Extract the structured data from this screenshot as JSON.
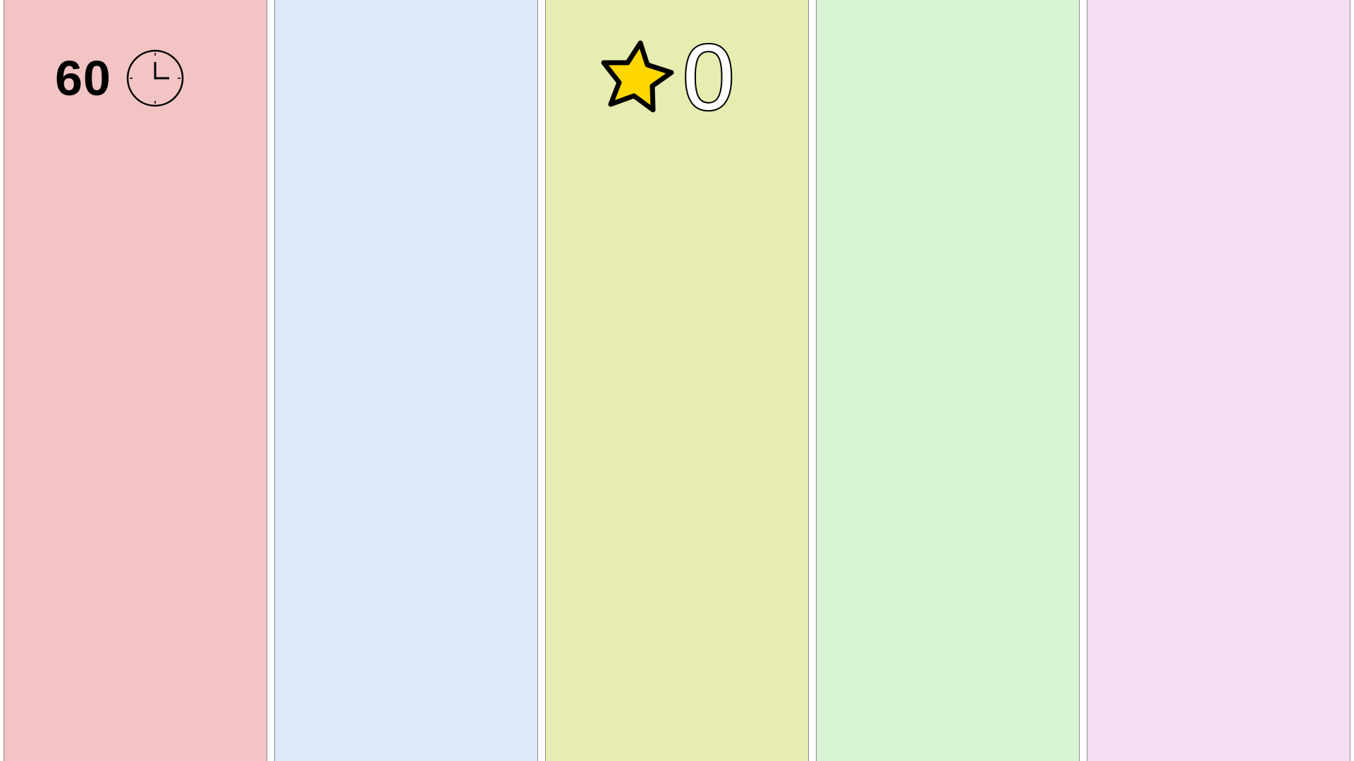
{
  "game": {
    "timer": {
      "value": "60",
      "icon": "clock-icon"
    },
    "score": {
      "value": "0",
      "icon": "star-icon",
      "star_color": "#FFD700"
    },
    "lanes": [
      {
        "color": "#F2C4C4"
      },
      {
        "color": "#E0E9FA"
      },
      {
        "color": "#E7EDB0"
      },
      {
        "color": "#D8F4D4"
      },
      {
        "color": "#F4DEF4"
      }
    ]
  }
}
